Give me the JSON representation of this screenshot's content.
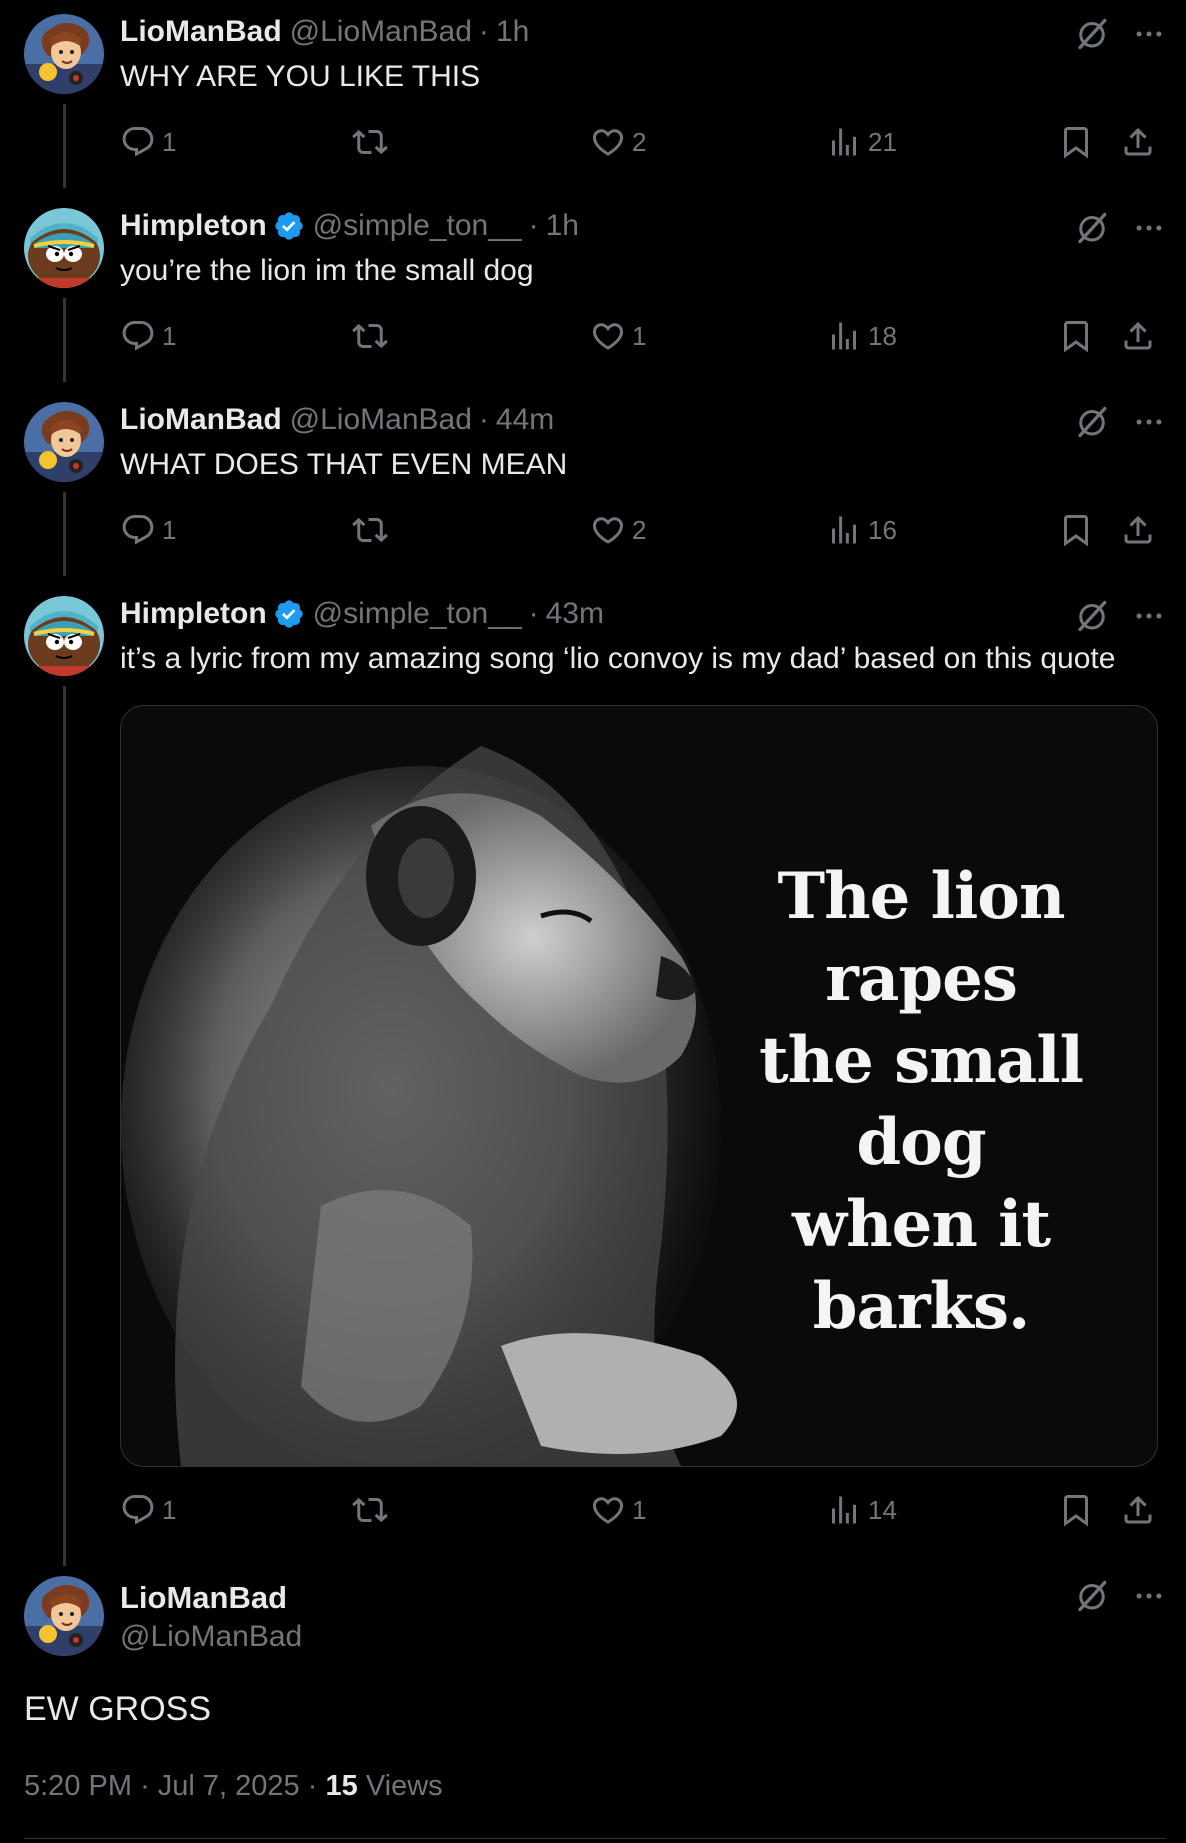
{
  "tweets": [
    {
      "name": "LioManBad",
      "verified": false,
      "handle": "@LioManBad",
      "time": "1h",
      "text": "WHY ARE YOU LIKE THIS",
      "replies": "1",
      "reposts": "",
      "likes": "2",
      "views": "21",
      "avatar": "anime-character"
    },
    {
      "name": "Himpleton",
      "verified": true,
      "handle": "@simple_ton__",
      "time": "1h",
      "text": "you’re the lion im the small dog",
      "replies": "1",
      "reposts": "",
      "likes": "1",
      "views": "18",
      "avatar": "cartoon-boy-face"
    },
    {
      "name": "LioManBad",
      "verified": false,
      "handle": "@LioManBad",
      "time": "44m",
      "text": "WHAT DOES THAT EVEN MEAN",
      "replies": "1",
      "reposts": "",
      "likes": "2",
      "views": "16",
      "avatar": "anime-character"
    },
    {
      "name": "Himpleton",
      "verified": true,
      "handle": "@simple_ton__",
      "time": "43m",
      "text": "it’s a lyric from my amazing song ‘lio convoy is my dad’ based on this quote",
      "replies": "1",
      "reposts": "",
      "likes": "1",
      "views": "14",
      "avatar": "cartoon-boy-face",
      "media": {
        "lines": [
          "The lion rapes",
          "the small dog",
          "when it barks."
        ]
      }
    }
  ],
  "main_tweet": {
    "name": "LioManBad",
    "handle": "@LioManBad",
    "text": "EW GROSS",
    "time": "5:20 PM",
    "date": "Jul 7, 2025",
    "views_count": "15",
    "views_label": "Views"
  },
  "separator": "·",
  "colors": {
    "background": "#000000",
    "text": "#e7e9ea",
    "muted": "#71767b",
    "verified": "#1d9bf0",
    "line": "#333639"
  }
}
